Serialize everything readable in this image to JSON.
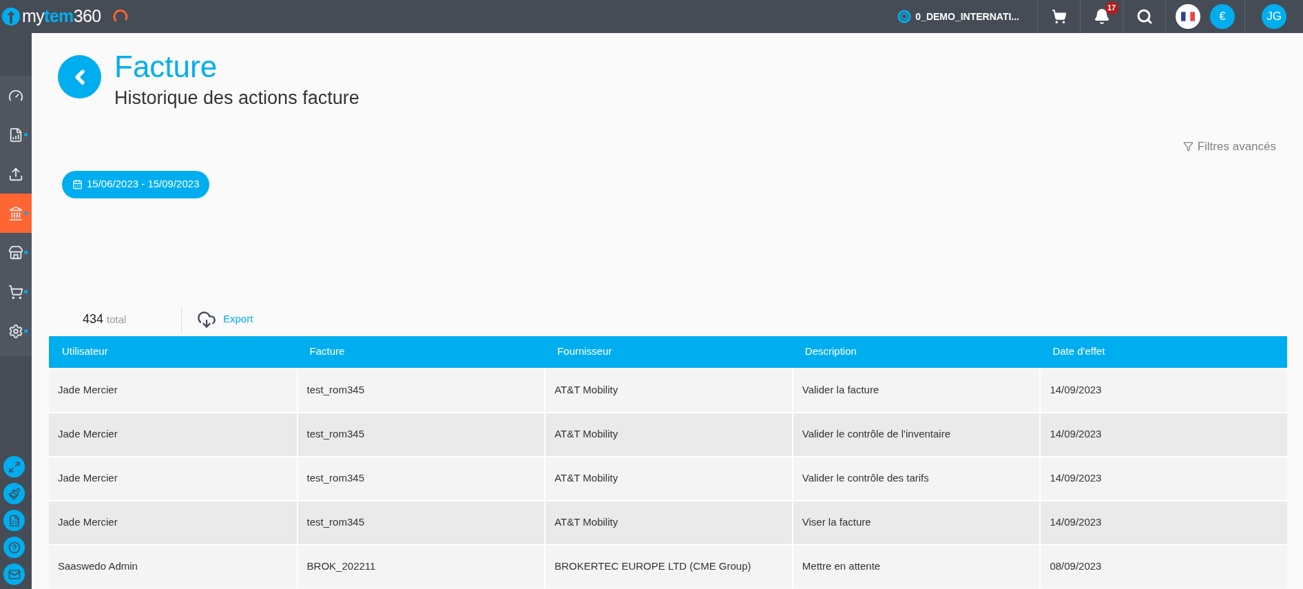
{
  "topbar": {
    "brand": "my**tem**360",
    "organization": "0_DEMO_INTERNATI...",
    "notifications_count": "17",
    "currency": "€",
    "user_initials": "JG"
  },
  "sidebar": {
    "items": [
      {
        "selected": false,
        "has_submenu": false
      },
      {
        "selected": false,
        "has_submenu": true
      },
      {
        "selected": false,
        "has_submenu": false
      },
      {
        "selected": true,
        "has_submenu": true
      },
      {
        "selected": false,
        "has_submenu": true
      },
      {
        "selected": false,
        "has_submenu": true
      },
      {
        "selected": false,
        "has_submenu": true
      }
    ]
  },
  "page": {
    "title": "Facture",
    "subtitle": "Historique des actions facture",
    "advanced_filters": "Filtres avancés",
    "date_range": "15/06/2023 - 15/09/2023",
    "count": "434",
    "count_label": "total",
    "export": "Export"
  },
  "table": {
    "columns": [
      "Utilisateur",
      "Facture",
      "Fournisseur",
      "Description",
      "Date d'effet"
    ],
    "rows": [
      [
        "Jade Mercier",
        "test_rom345",
        "AT&T Mobility",
        "Valider la facture",
        "14/09/2023"
      ],
      [
        "Jade Mercier",
        "test_rom345",
        "AT&T Mobility",
        "Valider le contrôle de l'inventaire",
        "14/09/2023"
      ],
      [
        "Jade Mercier",
        "test_rom345",
        "AT&T Mobility",
        "Valider le contrôle des tarifs",
        "14/09/2023"
      ],
      [
        "Jade Mercier",
        "test_rom345",
        "AT&T Mobility",
        "Viser la facture",
        "14/09/2023"
      ],
      [
        "Saaswedo Admin",
        "BROK_202211",
        "BROKERTEC EUROPE LTD (CME Group)",
        "Mettre en attente",
        "08/09/2023"
      ]
    ]
  }
}
